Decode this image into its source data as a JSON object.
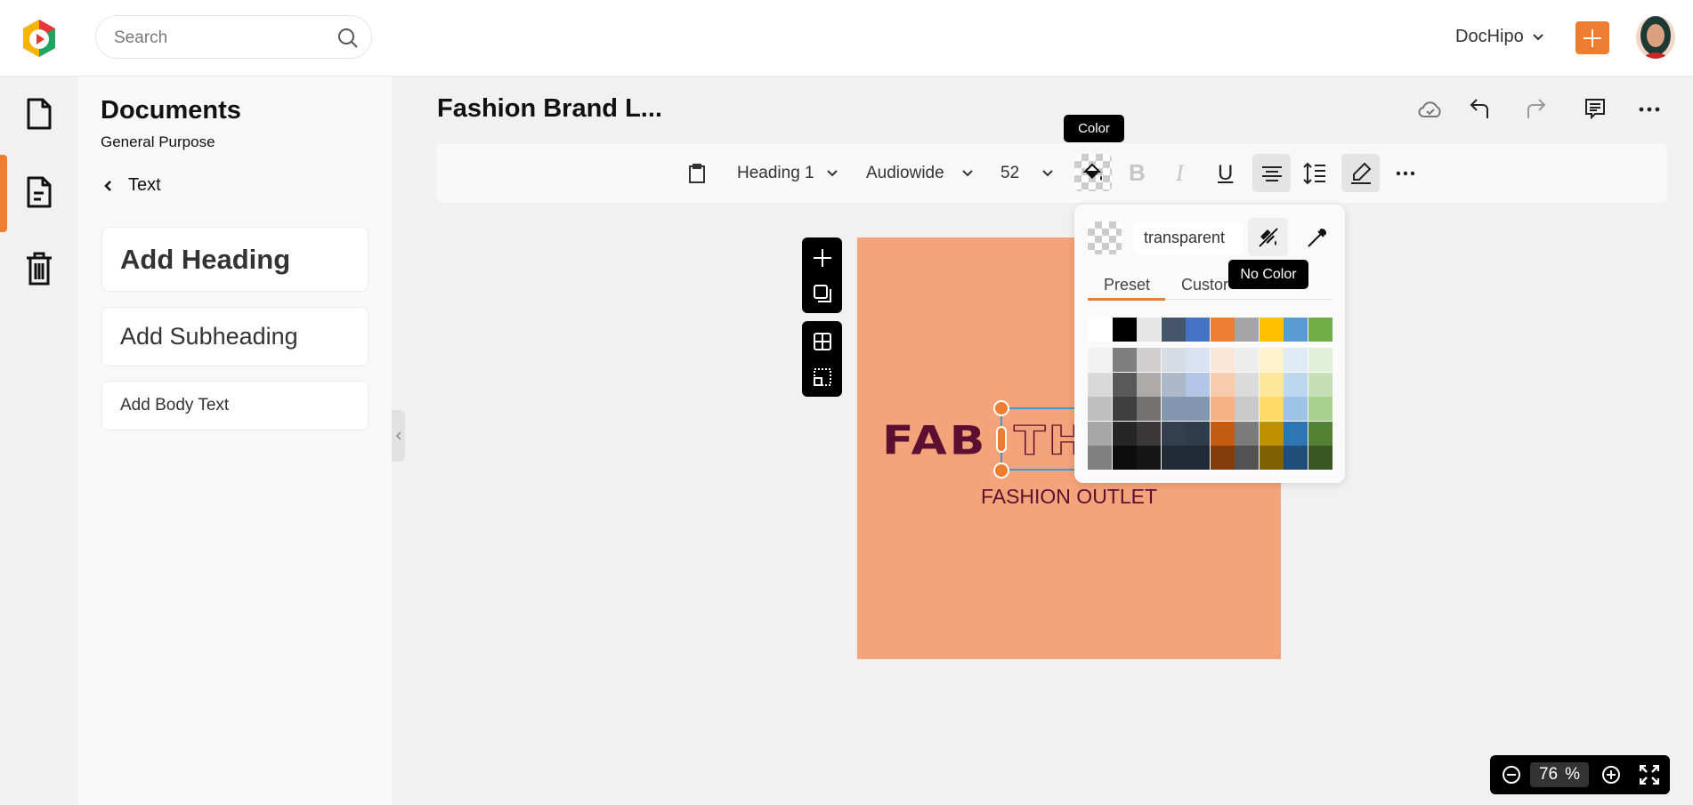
{
  "header": {
    "search_placeholder": "Search",
    "workspace": "DocHipo",
    "add_icon": "plus-icon",
    "brand_color": "#ed7d31"
  },
  "rail": {
    "items": [
      {
        "icon": "document-icon"
      },
      {
        "icon": "text-document-icon",
        "active": true
      },
      {
        "icon": "trash-icon"
      }
    ]
  },
  "panel": {
    "title": "Documents",
    "subtitle": "General Purpose",
    "back_label": "Text",
    "cards": [
      "Add Heading",
      "Add Subheading",
      "Add Body Text"
    ]
  },
  "document": {
    "title": "Fashion Brand L..."
  },
  "toolbar": {
    "style": "Heading 1",
    "font": "Audiowide",
    "size": "52",
    "color_tooltip": "Color",
    "bold": "B",
    "italic": "I",
    "underline": "U"
  },
  "color_picker": {
    "value": "transparent",
    "no_color_tooltip": "No Color",
    "tabs": [
      "Preset",
      "Custom"
    ],
    "tab_visible": [
      "Preset",
      "Custor"
    ],
    "active_tab": "Preset",
    "top_row": [
      "#ffffff",
      "#000000",
      "#e7e6e6",
      "#44546a",
      "#4472c4",
      "#ed7d31",
      "#a5a5a5",
      "#ffc000",
      "#5b9bd5",
      "#70ad47"
    ],
    "shades": [
      [
        "#f2f2f2",
        "#7f7f7f",
        "#d0cece",
        "#d6dce4",
        "#d9e2f3",
        "#fbe5d6",
        "#ededed",
        "#fff2cc",
        "#deebf7",
        "#e2f0d9"
      ],
      [
        "#d9d9d9",
        "#595959",
        "#aeaaaa",
        "#adb9ca",
        "#b4c6e7",
        "#f8cbad",
        "#dbdbdb",
        "#ffe699",
        "#bdd7ee",
        "#c5e0b4"
      ],
      [
        "#bfbfbf",
        "#3f3f3f",
        "#767171",
        "#8497b0",
        "#8497b0",
        "#f4b183",
        "#c9c9c9",
        "#ffd966",
        "#9dc3e6",
        "#a9d18e"
      ],
      [
        "#a6a6a6",
        "#262626",
        "#3a3838",
        "#333f4f",
        "#2f3c4c",
        "#c55a11",
        "#7b7b7b",
        "#bf9000",
        "#2e75b6",
        "#548235"
      ],
      [
        "#808080",
        "#0d0d0d",
        "#171616",
        "#222a35",
        "#1f2a36",
        "#843c0c",
        "#525252",
        "#7f6000",
        "#1f4e79",
        "#385723"
      ]
    ]
  },
  "canvas": {
    "background": "#f5a37a",
    "logo_word": "FAB",
    "logo_word2": "TH",
    "tagline": "FASHION OUTLET",
    "text_color": "#5c1030"
  },
  "zoom": {
    "value": "76",
    "unit": "%"
  }
}
